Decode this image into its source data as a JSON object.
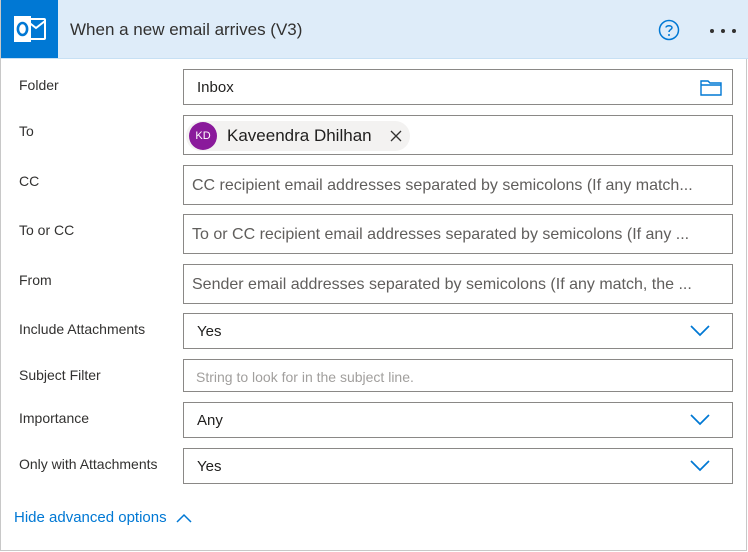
{
  "header": {
    "title": "When a new email arrives (V3)",
    "app_icon": "outlook-icon",
    "help_icon": "help-icon",
    "more_icon": "more-options-icon",
    "accent_color": "#0078d4",
    "header_bg": "#deecf9"
  },
  "fields": {
    "folder": {
      "label": "Folder",
      "value": "Inbox",
      "icon": "folder-icon"
    },
    "to": {
      "label": "To",
      "recipient_initials": "KD",
      "recipient_name": "Kaveendra Dhilhan",
      "avatar_color": "#8a1a9b"
    },
    "cc": {
      "label": "CC",
      "placeholder": "CC recipient email addresses separated by semicolons (If any match..."
    },
    "to_or_cc": {
      "label": "To or CC",
      "placeholder": "To or CC recipient email addresses separated by semicolons (If any ..."
    },
    "from": {
      "label": "From",
      "placeholder": "Sender email addresses separated by semicolons (If any match, the ..."
    },
    "include_attachments": {
      "label": "Include Attachments",
      "value": "Yes"
    },
    "subject_filter": {
      "label": "Subject Filter",
      "placeholder": "String to look for in the subject line."
    },
    "importance": {
      "label": "Importance",
      "value": "Any"
    },
    "only_with_attachments": {
      "label": "Only with Attachments",
      "value": "Yes"
    }
  },
  "footer": {
    "advanced_toggle": "Hide advanced options"
  }
}
